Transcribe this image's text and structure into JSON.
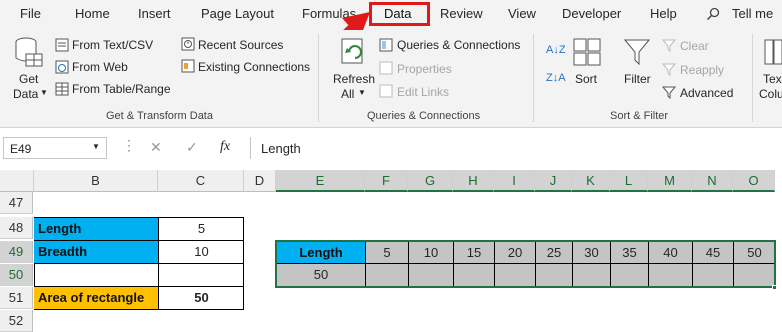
{
  "ribbon_tabs": [
    "File",
    "Home",
    "Insert",
    "Page Layout",
    "Formulas",
    "Data",
    "Review",
    "View",
    "Developer",
    "Help"
  ],
  "tell_me": "Tell me",
  "get_transform": {
    "get_data": "Get",
    "get_data2": "Data",
    "from_text": "From Text/CSV",
    "from_web": "From Web",
    "from_table": "From Table/Range",
    "recent": "Recent Sources",
    "existing": "Existing Connections",
    "label": "Get & Transform Data"
  },
  "queries": {
    "refresh": "Refresh",
    "refresh2": "All",
    "queries_conn": "Queries & Connections",
    "properties": "Properties",
    "edit_links": "Edit Links",
    "label": "Queries & Connections"
  },
  "sort_filter": {
    "sort": "Sort",
    "filter": "Filter",
    "clear": "Clear",
    "reapply": "Reapply",
    "advanced": "Advanced",
    "label": "Sort & Filter",
    "text_to": "Tex",
    "columns": "Colu"
  },
  "formula_bar": {
    "name_box": "E49",
    "fx": "fx",
    "value": "Length"
  },
  "columns": [
    "B",
    "C",
    "D",
    "E",
    "F",
    "G",
    "H",
    "I",
    "J",
    "K",
    "L",
    "M",
    "N",
    "O"
  ],
  "rows": [
    "47",
    "48",
    "49",
    "50",
    "51",
    "52"
  ],
  "cells": {
    "b48": "Length",
    "c48": "5",
    "b49": "Breadth",
    "c49": "10",
    "b51": "Area of rectangle",
    "c51": "50",
    "e49": "Length",
    "e50": "50",
    "row49_values": [
      "5",
      "10",
      "15",
      "20",
      "25",
      "30",
      "35",
      "40",
      "45",
      "50"
    ]
  }
}
